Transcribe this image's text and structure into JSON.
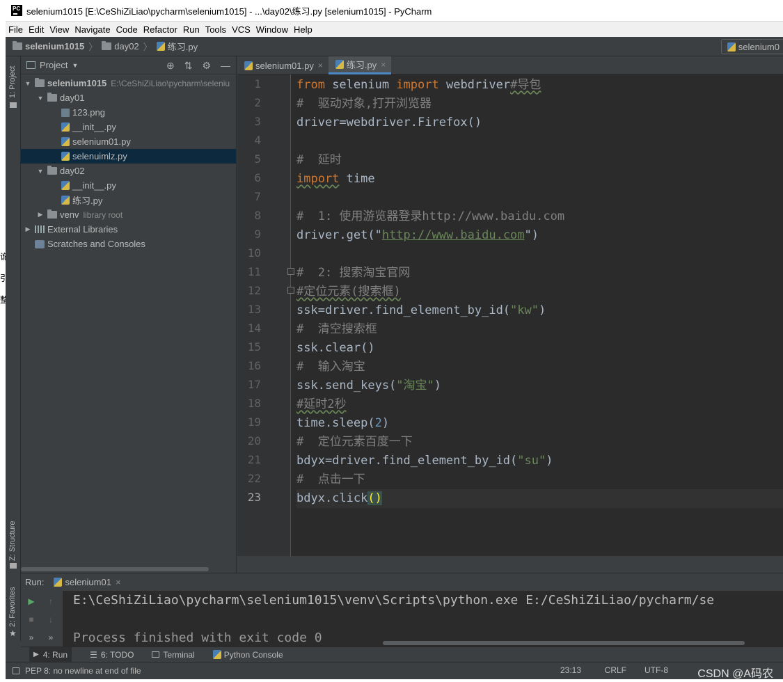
{
  "window": {
    "title": "selenium1015 [E:\\CeShiZiLiao\\pycharm\\selenium1015] - ...\\day02\\练习.py [selenium1015] - PyCharm"
  },
  "menu": [
    "File",
    "Edit",
    "View",
    "Navigate",
    "Code",
    "Refactor",
    "Run",
    "Tools",
    "VCS",
    "Window",
    "Help"
  ],
  "breadcrumbs": [
    "selenium1015",
    "day02",
    "练习.py"
  ],
  "nav_right": "selenium0",
  "side_tabs": {
    "project": "1: Project",
    "structure": "Z: Structure",
    "favorites": "2: Favorites"
  },
  "project": {
    "header": "Project",
    "root": {
      "name": "selenium1015",
      "path": "E:\\CeShiZiLiao\\pycharm\\seleniu"
    },
    "items": [
      {
        "name": "day01"
      },
      {
        "name": "123.png"
      },
      {
        "name": "__init__.py"
      },
      {
        "name": "selenium01.py"
      },
      {
        "name": "selenuimlz.py"
      },
      {
        "name": "day02"
      },
      {
        "name": "__init__.py"
      },
      {
        "name": "练习.py"
      },
      {
        "name": "venv",
        "note": "library root"
      },
      {
        "name": "External Libraries"
      },
      {
        "name": "Scratches and Consoles"
      }
    ]
  },
  "editor_tabs": [
    "selenium01.py",
    "练习.py"
  ],
  "line_numbers": [
    "1",
    "2",
    "3",
    "4",
    "5",
    "6",
    "7",
    "8",
    "9",
    "10",
    "11",
    "12",
    "13",
    "14",
    "15",
    "16",
    "17",
    "18",
    "19",
    "20",
    "21",
    "22",
    "23"
  ],
  "code": {
    "l1a": "from",
    "l1b": " selenium ",
    "l1c": "import",
    "l1d": " webdriver",
    "l1e": "#导包",
    "l2": "#  驱动对象,打开浏览器",
    "l3": "driver=webdriver.Firefox()",
    "l5": "#  延时",
    "l6a": "import",
    "l6b": " time",
    "l8": "#  1: 使用游览器登录http://www.baidu.com",
    "l9a": "driver.get(\"",
    "l9b": "http://www.baidu.com",
    "l9c": "\")",
    "l11": "#  2: 搜索淘宝官网",
    "l12": "#定位元素(搜索框)",
    "l13a": "ssk=driver.find_element_by_id(",
    "l13b": "\"kw\"",
    "l13c": ")",
    "l14": "#  清空搜索框",
    "l15": "ssk.clear()",
    "l16": "#  输入淘宝",
    "l17a": "ssk.send_keys(",
    "l17b": "\"淘宝\"",
    "l17c": ")",
    "l18": "#延时2秒",
    "l19a": "time.sleep(",
    "l19b": "2",
    "l19c": ")",
    "l20": "#  定位元素百度一下",
    "l21a": "bdyx=driver.find_element_by_id(",
    "l21b": "\"su\"",
    "l21c": ")",
    "l22": "#  点击一下",
    "l23a": "bdyx.click",
    "l23b": "()"
  },
  "run": {
    "label": "Run:",
    "config": "selenium01",
    "output": [
      "E:\\CeShiZiLiao\\pycharm\\selenium1015\\venv\\Scripts\\python.exe E:/CeShiZiLiao/pycharm/se",
      "",
      "Process finished with exit code 0"
    ]
  },
  "bottom_tabs": [
    "4: Run",
    "6: TODO",
    "Terminal",
    "Python Console"
  ],
  "status": {
    "message": "PEP 8: no newline at end of file",
    "position": "23:13",
    "line_sep": "CRLF",
    "encoding": "UTF-8",
    "watermark": "CSDN @A码农"
  }
}
